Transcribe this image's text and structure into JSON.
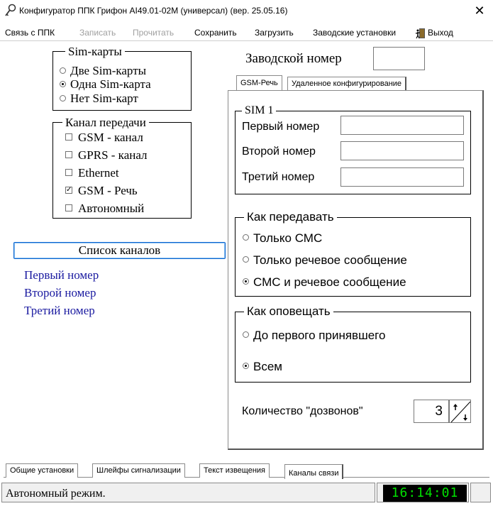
{
  "window": {
    "title": "Конфигуратор ППК Грифон AI49.01-02М (универсал) (вер. 25.05.16)",
    "close_glyph": "✕"
  },
  "menu": {
    "items": [
      {
        "label": "Связь с ППК",
        "enabled": true
      },
      {
        "label": "Записать",
        "enabled": false
      },
      {
        "label": "Прочитать",
        "enabled": false
      },
      {
        "label": "Сохранить",
        "enabled": true
      },
      {
        "label": "Загрузить",
        "enabled": true
      },
      {
        "label": "Заводские установки",
        "enabled": true
      },
      {
        "label": "Выход",
        "enabled": true
      }
    ]
  },
  "sim_group": {
    "title": "Sim-карты",
    "options": [
      {
        "label": "Две Sim-карты",
        "selected": false
      },
      {
        "label": "Одна Sim-карта",
        "selected": true
      },
      {
        "label": "Нет Sim-карт",
        "selected": false
      }
    ]
  },
  "channel_group": {
    "title": "Канал передачи",
    "options": [
      {
        "label": "GSM - канал",
        "checked": false
      },
      {
        "label": "GPRS - канал",
        "checked": false
      },
      {
        "label": "Ethernet",
        "checked": false
      },
      {
        "label": "GSM - Речь",
        "checked": true
      },
      {
        "label": "Автономный",
        "checked": false
      }
    ]
  },
  "channel_list": {
    "button_label": "Список каналов",
    "items": [
      "Первый номер",
      "Второй номер",
      "Третий номер"
    ]
  },
  "factory_number": {
    "label": "Заводской номер",
    "value": ""
  },
  "right_tabs": [
    {
      "label": "GSM-Речь",
      "active": true
    },
    {
      "label": "Удаленное конфигурирование",
      "active": false
    }
  ],
  "sim1": {
    "title": "SIM 1",
    "fields": [
      {
        "label": "Первый номер",
        "value": ""
      },
      {
        "label": "Второй номер",
        "value": ""
      },
      {
        "label": "Третий номер",
        "value": ""
      }
    ]
  },
  "how_send": {
    "title": "Как передавать",
    "options": [
      {
        "label": "Только СМС",
        "selected": false
      },
      {
        "label": "Только речевое сообщение",
        "selected": false
      },
      {
        "label": "СМС и речевое сообщение",
        "selected": true
      }
    ]
  },
  "how_notify": {
    "title": "Как оповещать",
    "options": [
      {
        "label": "До первого принявшего",
        "selected": false
      },
      {
        "label": "Всем",
        "selected": true
      }
    ]
  },
  "redial": {
    "label": "Количество \"дозвонов\"",
    "value": "3"
  },
  "bottom_tabs": [
    {
      "label": "Общие установки",
      "active": false
    },
    {
      "label": "Шлейфы сигнализации",
      "active": false
    },
    {
      "label": "Текст извещения",
      "active": false
    },
    {
      "label": "Каналы связи",
      "active": true
    }
  ],
  "status": {
    "text": "Автономный режим.",
    "clock": "16:14:01"
  },
  "colors": {
    "link_blue": "#1a1aa0",
    "clock_bg": "#000000",
    "clock_fg": "#00e000"
  }
}
